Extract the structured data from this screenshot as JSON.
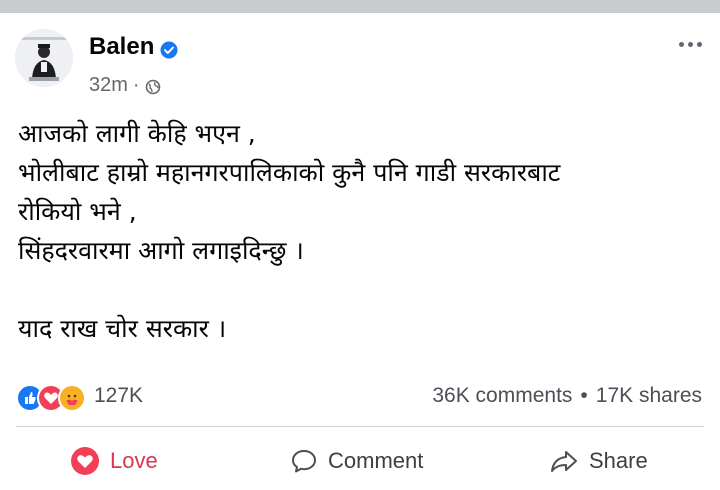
{
  "post": {
    "author": "Balen",
    "time": "32m",
    "separator": "·",
    "lines": [
      "आजको लागी केहि भएन ,",
      "भोलीबाट हाम्रो महानगरपालिकाको कुनै पनि गाडी सरकारबाट",
      "रोकियो भने ,",
      "सिंहदरवारमा आगो लगाइदिन्छु ।",
      "",
      "याद राख चोर सरकार ।"
    ]
  },
  "stats": {
    "reactions_count": "127K",
    "comments": "36K comments",
    "dot": "•",
    "shares": "17K shares"
  },
  "actions": {
    "love": "Love",
    "comment": "Comment",
    "share": "Share"
  },
  "colors": {
    "love": "#d9374d",
    "like": "#1877f2",
    "care": "#f7b125",
    "muted": "#65676b"
  }
}
